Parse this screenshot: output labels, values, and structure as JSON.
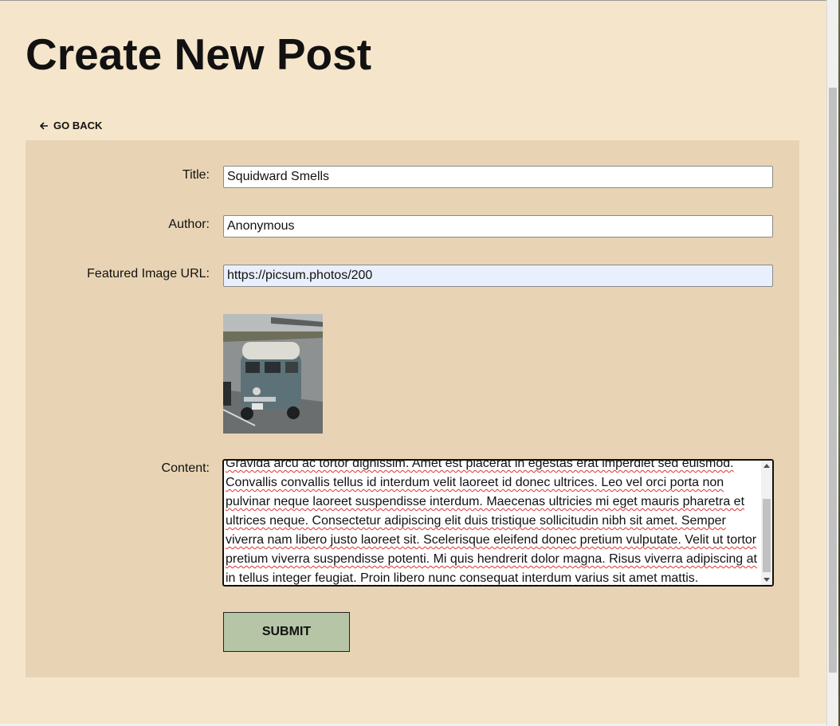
{
  "page": {
    "title": "Create New Post",
    "go_back_label": "GO BACK"
  },
  "form": {
    "title_label": "Title:",
    "title_value": "Squidward Smells",
    "author_label": "Author:",
    "author_value": "Anonymous",
    "image_label": "Featured Image URL:",
    "image_value": "https://picsum.photos/200",
    "content_label": "Content:",
    "content_lines": [
      "Gravida arcu ac tortor dignissim. Amet est placerat in egestas erat imperdiet sed euismod.",
      "Convallis convallis tellus id interdum velit laoreet id donec ultrices. Leo vel orci porta non",
      "pulvinar neque laoreet suspendisse interdum. Maecenas ultricies mi eget mauris pharetra et",
      "ultrices neque. Consectetur adipiscing elit duis tristique sollicitudin nibh sit amet. Semper",
      "viverra nam libero justo laoreet sit. Scelerisque eleifend donec pretium vulputate. Velit ut tortor",
      "pretium viverra suspendisse potenti. Mi quis hendrerit dolor magna. Risus viverra adipiscing at",
      "in tellus integer feugiat. Proin libero nunc consequat interdum varius sit amet mattis."
    ],
    "submit_label": "SUBMIT"
  },
  "icons": {
    "back": "arrow-left-icon"
  },
  "colors": {
    "page_bg": "#f5e5cb",
    "panel_bg": "#e8d4b4",
    "submit_bg": "#b5c5a6"
  }
}
